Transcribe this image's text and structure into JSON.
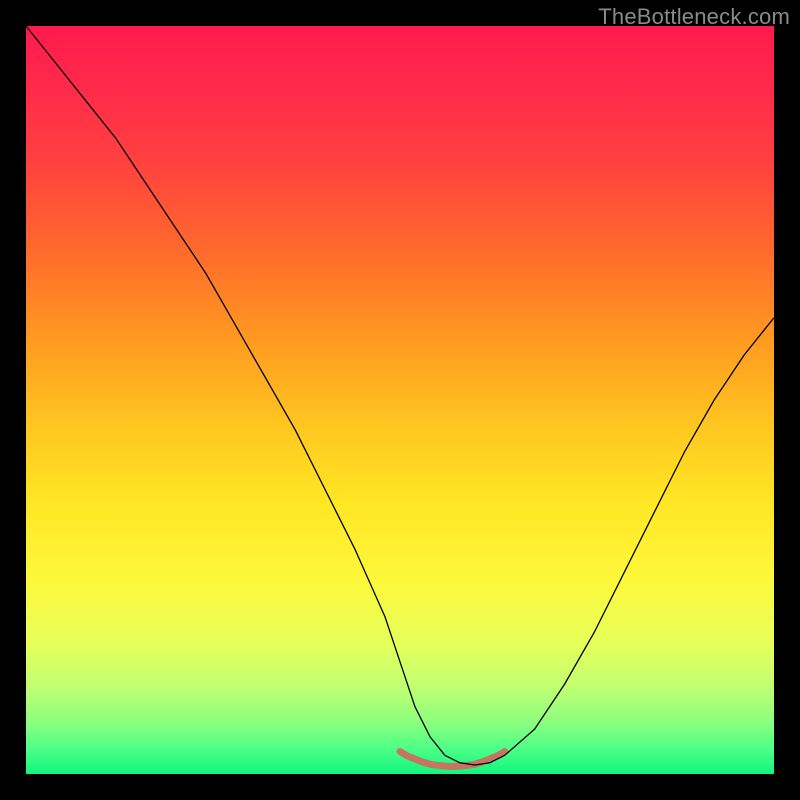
{
  "watermark": "TheBottleneck.com",
  "chart_data": {
    "type": "line",
    "title": "",
    "xlabel": "",
    "ylabel": "",
    "xlim": [
      0,
      100
    ],
    "ylim": [
      0,
      100
    ],
    "grid": false,
    "legend": false,
    "series": [
      {
        "name": "main-curve",
        "stroke": "#000000",
        "stroke_width": 1.3,
        "x": [
          0,
          4,
          8,
          12,
          16,
          20,
          24,
          28,
          32,
          36,
          40,
          44,
          48,
          50,
          52,
          54,
          56,
          58,
          60,
          62,
          64,
          68,
          72,
          76,
          80,
          84,
          88,
          92,
          96,
          100
        ],
        "y": [
          100,
          95,
          90,
          85,
          79,
          73,
          67,
          60,
          53,
          46,
          38,
          30,
          21,
          15,
          9,
          5,
          2.5,
          1.5,
          1.2,
          1.5,
          2.5,
          6,
          12,
          19,
          27,
          35,
          43,
          50,
          56,
          61
        ]
      },
      {
        "name": "bottom-band",
        "stroke": "#d06a60",
        "stroke_width": 7,
        "x": [
          50,
          51,
          52,
          53,
          54,
          55,
          56,
          57,
          58,
          59,
          60,
          61,
          62,
          63,
          64
        ],
        "y": [
          3.0,
          2.4,
          2.0,
          1.6,
          1.3,
          1.15,
          1.05,
          1.0,
          1.05,
          1.15,
          1.3,
          1.6,
          2.0,
          2.4,
          3.0
        ]
      }
    ]
  }
}
